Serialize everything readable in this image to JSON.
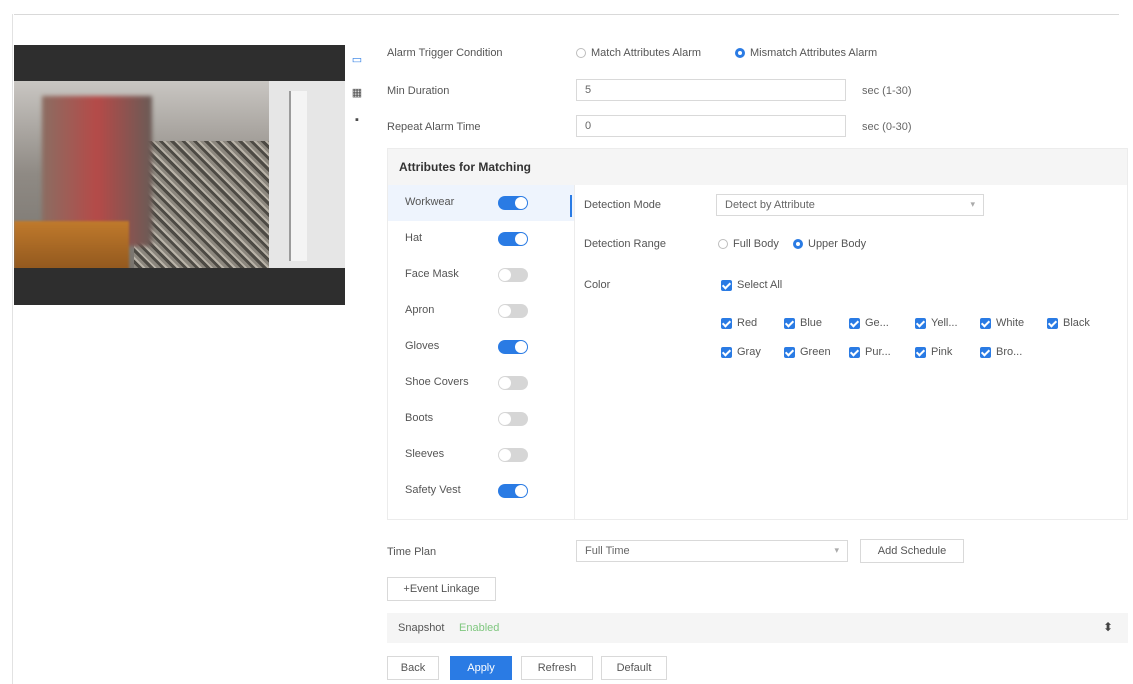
{
  "trigger": {
    "label": "Alarm Trigger Condition",
    "options": [
      "Match Attributes Alarm",
      "Mismatch Attributes Alarm"
    ],
    "selected": 1
  },
  "min_duration": {
    "label": "Min Duration",
    "value": "5",
    "unit": "sec (1-30)"
  },
  "repeat": {
    "label": "Repeat Alarm Time",
    "value": "0",
    "unit": "sec (0-30)"
  },
  "attributes": {
    "title": "Attributes for Matching",
    "items": [
      {
        "label": "Workwear",
        "on": true
      },
      {
        "label": "Hat",
        "on": true
      },
      {
        "label": "Face Mask",
        "on": false
      },
      {
        "label": "Apron",
        "on": false
      },
      {
        "label": "Gloves",
        "on": true
      },
      {
        "label": "Shoe Covers",
        "on": false
      },
      {
        "label": "Boots",
        "on": false
      },
      {
        "label": "Sleeves",
        "on": false
      },
      {
        "label": "Safety Vest",
        "on": true
      }
    ]
  },
  "detail": {
    "mode_label": "Detection Mode",
    "mode_value": "Detect by Attribute",
    "range_label": "Detection Range",
    "range_options": [
      "Full Body",
      "Upper Body"
    ],
    "range_selected": 1,
    "color_label": "Color",
    "select_all": "Select All",
    "colors": [
      "Red",
      "Blue",
      "Ge...",
      "Yell...",
      "White",
      "Black",
      "Gray",
      "Green",
      "Pur...",
      "Pink",
      "Bro..."
    ]
  },
  "schedule": {
    "label": "Time Plan",
    "value": "Full Time",
    "add_label": "Add Schedule"
  },
  "linkage_label": "+Event Linkage",
  "snapshot": {
    "label": "Snapshot",
    "value": "Enabled"
  },
  "buttons": {
    "back": "Back",
    "apply": "Apply",
    "refresh": "Refresh",
    "default": "Default"
  },
  "colors": {
    "accent": "#2a7be4"
  }
}
